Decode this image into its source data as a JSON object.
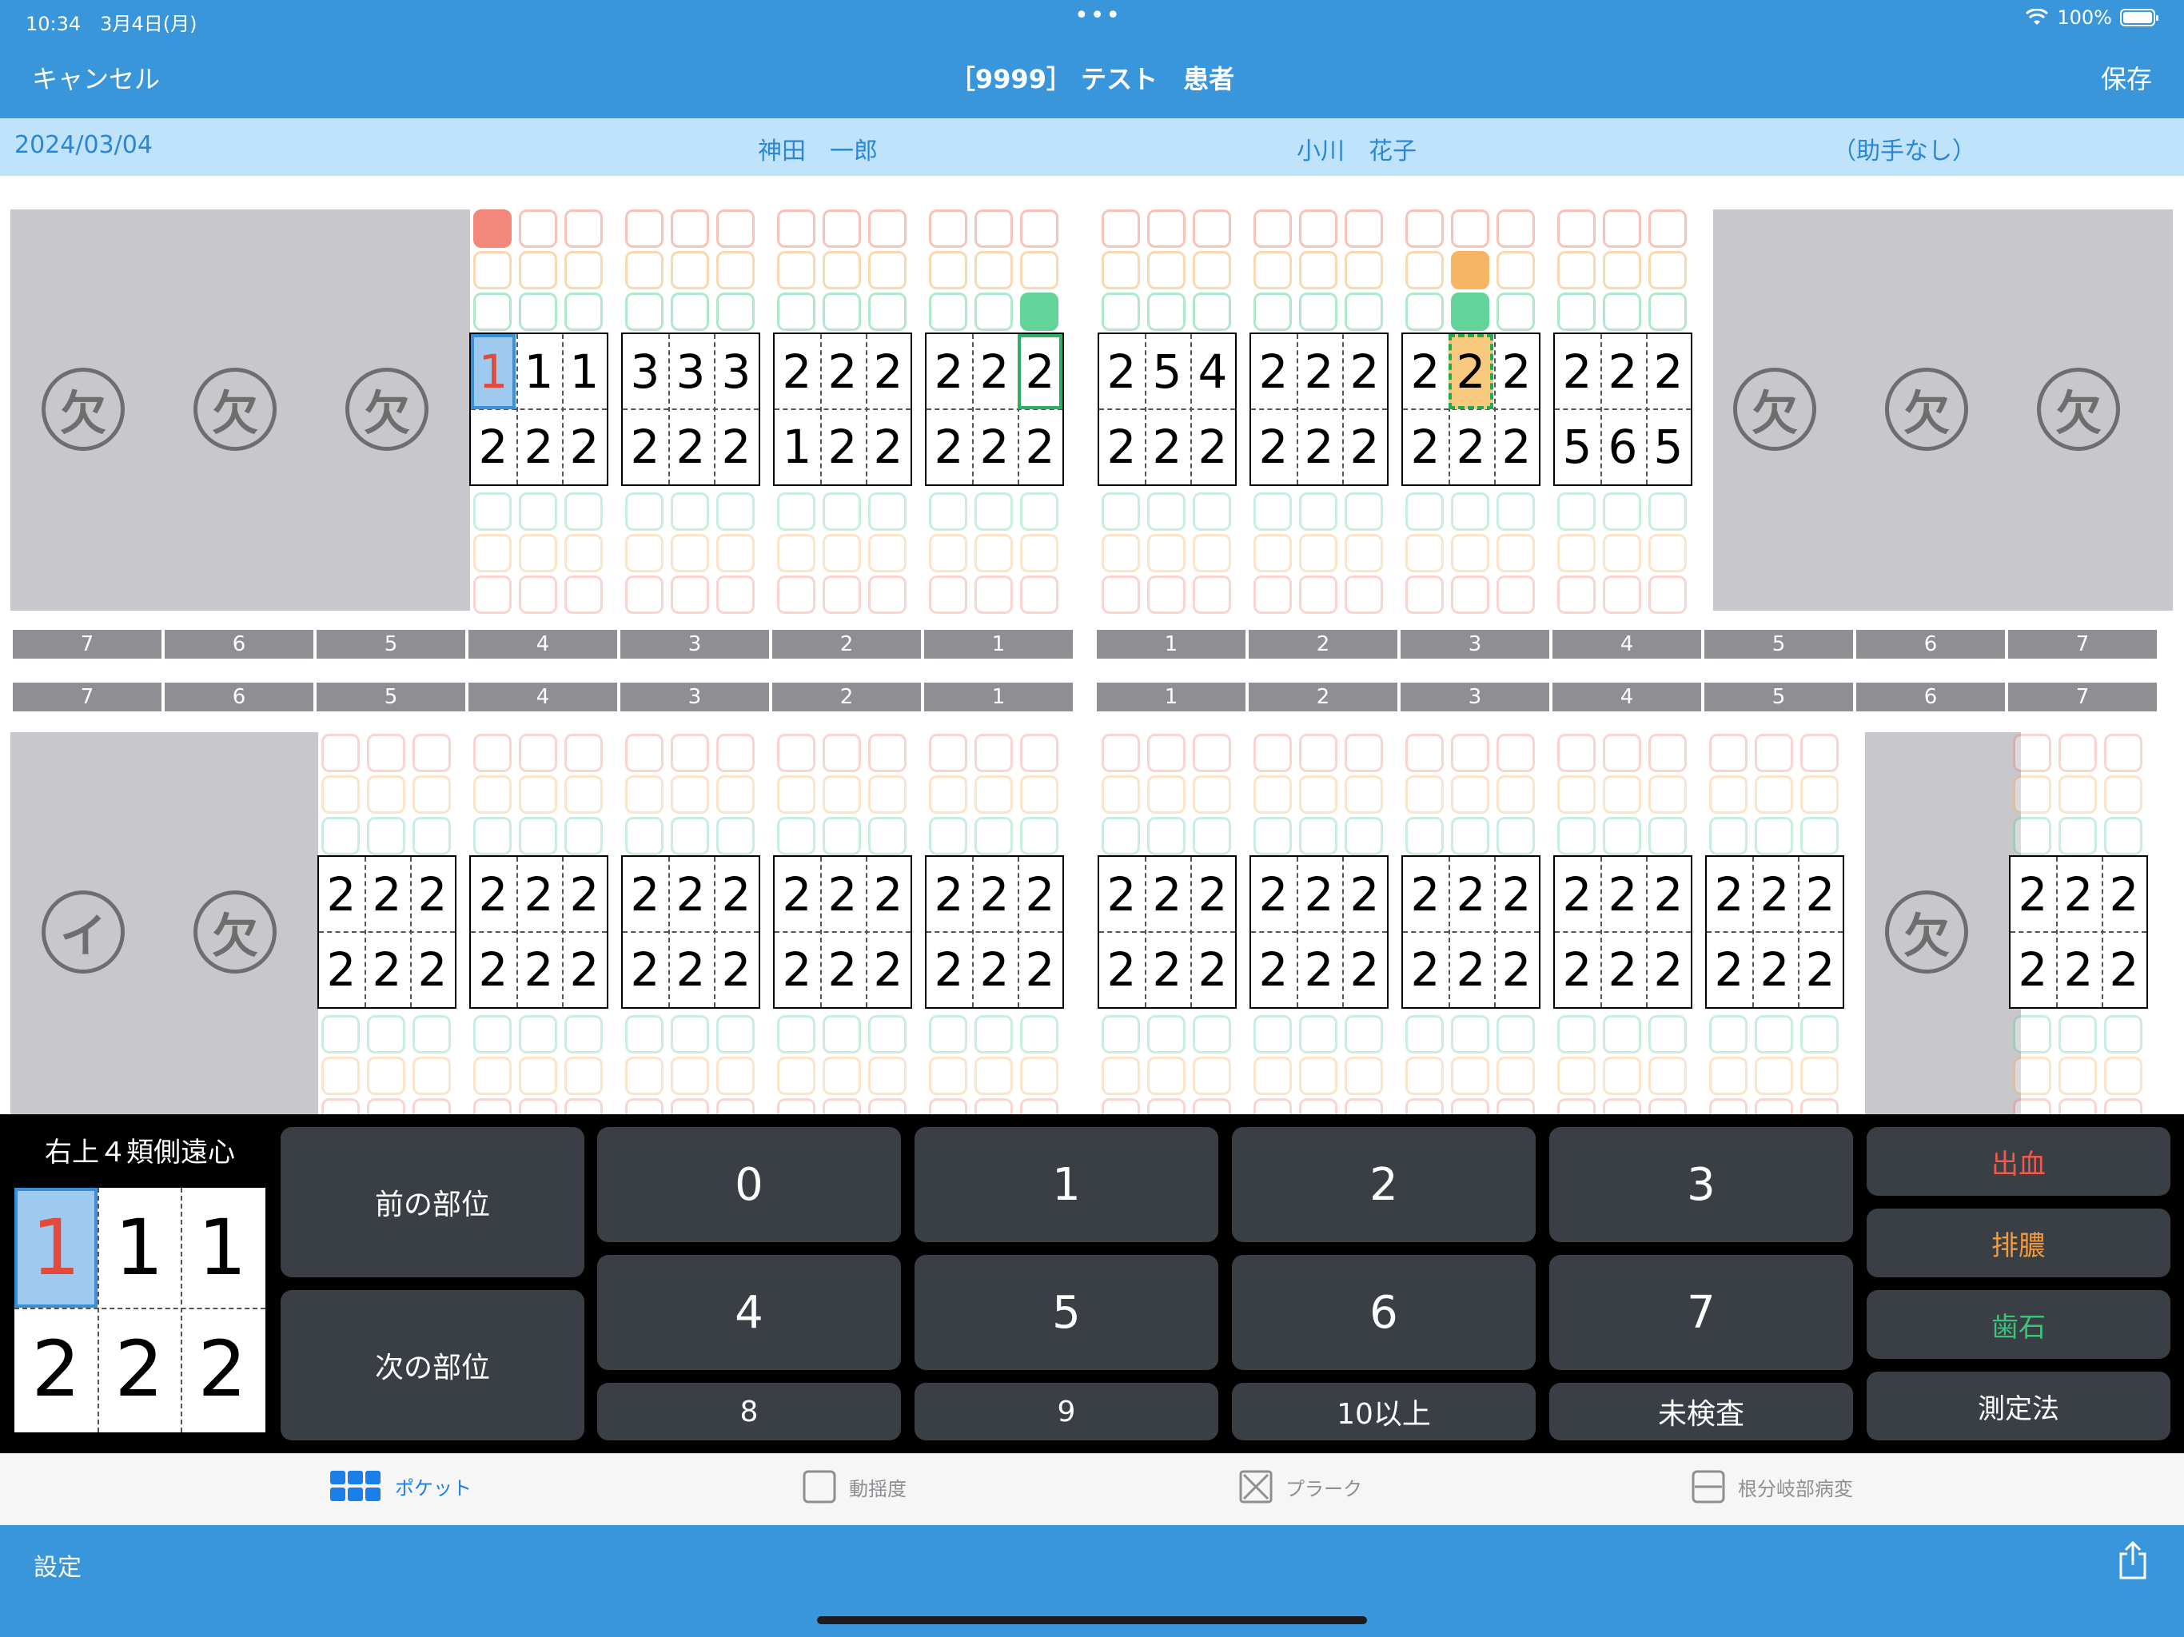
{
  "status_bar": {
    "time": "10:34",
    "date": "3月4日(月)",
    "dots": "•••",
    "battery": "100%"
  },
  "nav": {
    "cancel": "キャンセル",
    "title": "［9999］ テスト　患者",
    "save": "保存"
  },
  "info": {
    "date": "2024/03/04",
    "doctor": "神田　一郎",
    "hygienist": "小川　花子",
    "assistant": "（助手なし）"
  },
  "seal_missing": "欠",
  "seal_implant": "イ",
  "colors": {
    "bleeding": "#f2877a",
    "pus": "#f5b565",
    "calculus": "#62d49a"
  },
  "upper_teeth": [
    {
      "pos": "R7",
      "missing": true
    },
    {
      "pos": "R6",
      "missing": true
    },
    {
      "pos": "R5",
      "missing": true
    },
    {
      "pos": "R4",
      "buccal": [
        "1",
        "1",
        "1"
      ],
      "lingual": [
        "2",
        "2",
        "2"
      ],
      "selected": 0,
      "bleeding": [
        0
      ]
    },
    {
      "pos": "R3",
      "buccal": [
        "3",
        "3",
        "3"
      ],
      "lingual": [
        "2",
        "2",
        "2"
      ]
    },
    {
      "pos": "R2",
      "buccal": [
        "2",
        "2",
        "2"
      ],
      "lingual": [
        "1",
        "2",
        "2"
      ]
    },
    {
      "pos": "R1",
      "buccal": [
        "2",
        "2",
        "2"
      ],
      "lingual": [
        "2",
        "2",
        "2"
      ],
      "green_outline": 2,
      "calculus": [
        2
      ]
    },
    {
      "pos": "L1",
      "buccal": [
        "2",
        "5",
        "4"
      ],
      "lingual": [
        "2",
        "2",
        "2"
      ]
    },
    {
      "pos": "L2",
      "buccal": [
        "2",
        "2",
        "2"
      ],
      "lingual": [
        "2",
        "2",
        "2"
      ]
    },
    {
      "pos": "L3",
      "buccal": [
        "2",
        "2",
        "2"
      ],
      "lingual": [
        "2",
        "2",
        "2"
      ],
      "orange_fill": 1,
      "pus": [
        1
      ],
      "calculus": [
        1
      ]
    },
    {
      "pos": "L4",
      "buccal": [
        "2",
        "2",
        "2"
      ],
      "lingual": [
        "5",
        "6",
        "5"
      ]
    },
    {
      "pos": "L5",
      "missing": true
    },
    {
      "pos": "L6",
      "missing": true
    },
    {
      "pos": "L7",
      "missing": true
    }
  ],
  "lower_teeth": [
    {
      "pos": "R7",
      "seal": "イ"
    },
    {
      "pos": "R6",
      "seal": "欠"
    },
    {
      "pos": "R5",
      "buccal": [
        "2",
        "2",
        "2"
      ],
      "lingual": [
        "2",
        "2",
        "2"
      ]
    },
    {
      "pos": "R4",
      "buccal": [
        "2",
        "2",
        "2"
      ],
      "lingual": [
        "2",
        "2",
        "2"
      ]
    },
    {
      "pos": "R3",
      "buccal": [
        "2",
        "2",
        "2"
      ],
      "lingual": [
        "2",
        "2",
        "2"
      ]
    },
    {
      "pos": "R2",
      "buccal": [
        "2",
        "2",
        "2"
      ],
      "lingual": [
        "2",
        "2",
        "2"
      ]
    },
    {
      "pos": "R1",
      "buccal": [
        "2",
        "2",
        "2"
      ],
      "lingual": [
        "2",
        "2",
        "2"
      ]
    },
    {
      "pos": "L1",
      "buccal": [
        "2",
        "2",
        "2"
      ],
      "lingual": [
        "2",
        "2",
        "2"
      ]
    },
    {
      "pos": "L2",
      "buccal": [
        "2",
        "2",
        "2"
      ],
      "lingual": [
        "2",
        "2",
        "2"
      ]
    },
    {
      "pos": "L3",
      "buccal": [
        "2",
        "2",
        "2"
      ],
      "lingual": [
        "2",
        "2",
        "2"
      ]
    },
    {
      "pos": "L4",
      "buccal": [
        "2",
        "2",
        "2"
      ],
      "lingual": [
        "2",
        "2",
        "2"
      ]
    },
    {
      "pos": "L5",
      "buccal": [
        "2",
        "2",
        "2"
      ],
      "lingual": [
        "2",
        "2",
        "2"
      ]
    },
    {
      "pos": "L6",
      "seal": "欠"
    },
    {
      "pos": "L7",
      "buccal": [
        "2",
        "2",
        "2"
      ],
      "lingual": [
        "2",
        "2",
        "2"
      ]
    }
  ],
  "tooth_numbers_left": [
    "7",
    "6",
    "5",
    "4",
    "3",
    "2",
    "1"
  ],
  "tooth_numbers_right": [
    "1",
    "2",
    "3",
    "4",
    "5",
    "6",
    "7"
  ],
  "keypad": {
    "site_label": "右上４頬側遠心",
    "mini_buccal": [
      "1",
      "1",
      "1"
    ],
    "mini_lingual": [
      "2",
      "2",
      "2"
    ],
    "prev": "前の部位",
    "next": "次の部位",
    "digits": [
      "0",
      "1",
      "2",
      "3",
      "4",
      "5",
      "6",
      "7"
    ],
    "bottom_keys": [
      "8",
      "9",
      "10以上",
      "未検査"
    ],
    "bleeding": "出血",
    "pus": "排膿",
    "calculus": "歯石",
    "method": "測定法"
  },
  "tabs": [
    {
      "label": "ポケット",
      "icon": "grid-icon",
      "active": true
    },
    {
      "label": "動揺度",
      "icon": "square-icon",
      "active": false
    },
    {
      "label": "プラーク",
      "icon": "crossed-square-icon",
      "active": false
    },
    {
      "label": "根分岐部病変",
      "icon": "split-square-icon",
      "active": false
    }
  ],
  "bottom": {
    "settings": "設定"
  }
}
